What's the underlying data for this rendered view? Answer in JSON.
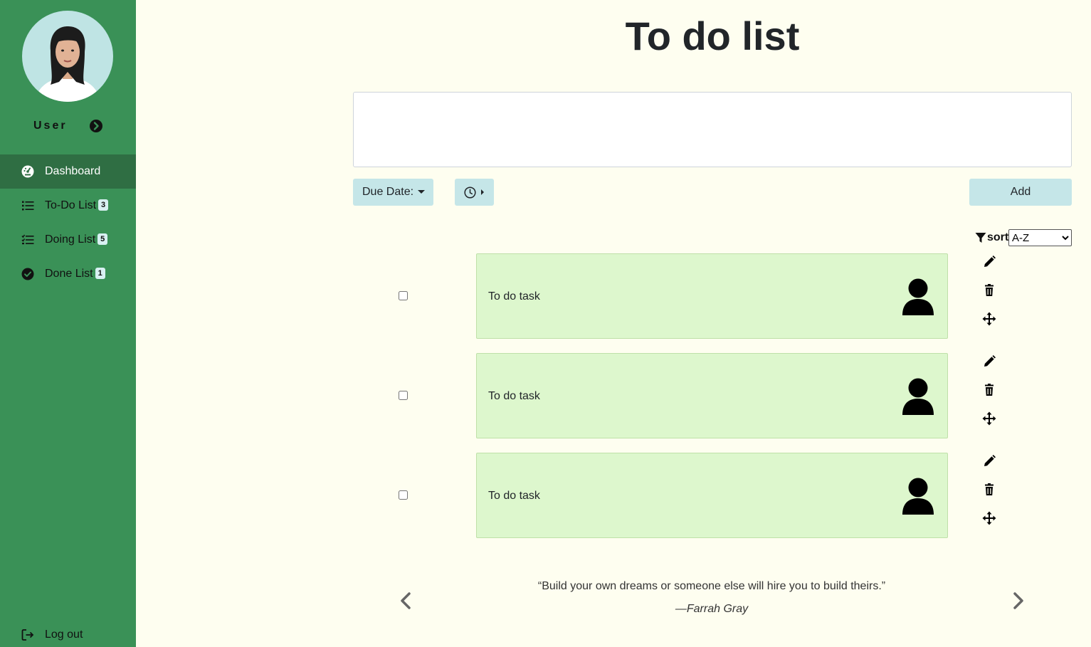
{
  "sidebar": {
    "user_name": "User",
    "items": [
      {
        "label": "Dashboard",
        "icon": "dashboard-gauge-icon",
        "badge": null
      },
      {
        "label": "To-Do List",
        "icon": "list-icon",
        "badge": "3"
      },
      {
        "label": "Doing List",
        "icon": "checklist-icon",
        "badge": "5"
      },
      {
        "label": "Done List",
        "icon": "check-circle-icon",
        "badge": "1"
      }
    ],
    "logout_label": "Log out",
    "active_item": "Dashboard"
  },
  "main": {
    "title": "To do list",
    "input_value": "",
    "due_date_label": "Due Date:",
    "add_label": "Add",
    "sort_label": "sort",
    "sort_value": "A-Z",
    "tasks": [
      {
        "text": "To do task",
        "checked": false
      },
      {
        "text": "To do task",
        "checked": false
      },
      {
        "text": "To do task",
        "checked": false
      }
    ],
    "quote": {
      "text": "“Build your own dreams or someone else will hire you to build theirs.”",
      "author": "—Farrah Gray"
    }
  },
  "colors": {
    "sidebar_bg": "#3a9157",
    "sidebar_active_bg": "#2f6e43",
    "page_bg": "#fefef0",
    "task_card_bg": "#ddf7cd",
    "button_bg": "#c5e6e8"
  }
}
